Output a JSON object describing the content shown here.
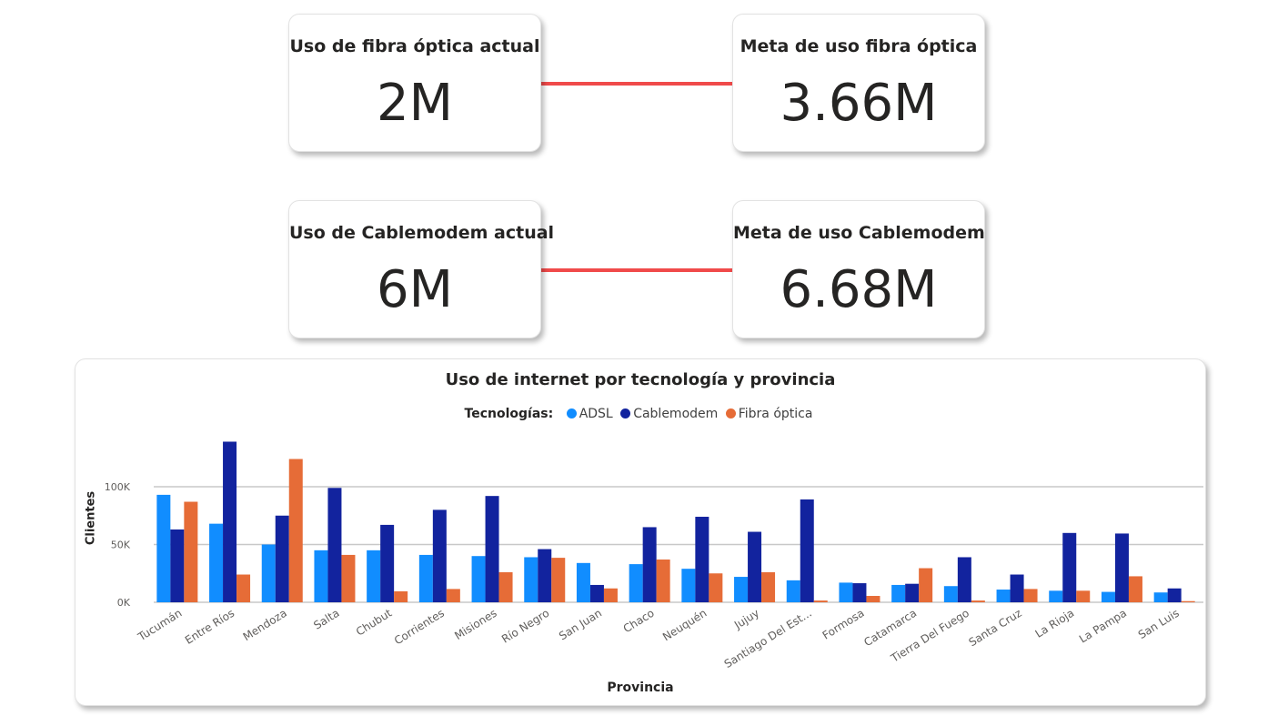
{
  "kpis": {
    "fibra_actual": {
      "title": "Uso de fibra óptica actual",
      "value": "2M"
    },
    "fibra_meta": {
      "title": "Meta de uso fibra óptica",
      "value": "3.66M"
    },
    "cable_actual": {
      "title": "Uso de Cablemodem actual",
      "value": "6M"
    },
    "cable_meta": {
      "title": "Meta de uso Cablemodem",
      "value": "6.68M"
    }
  },
  "colors": {
    "connector": "#f04a4a",
    "adsl": "#118dff",
    "cablemodem": "#12239e",
    "fibra": "#e66c37",
    "grid": "#c8c8c8"
  },
  "chart_data": {
    "type": "bar",
    "title": "Uso de internet por tecnología y provincia",
    "legend_title": "Tecnologías:",
    "legend_position": "top-center",
    "xlabel": "Provincia",
    "ylabel": "Clientes",
    "ylim": [
      0,
      145000
    ],
    "yticks": [
      0,
      50000,
      100000
    ],
    "ytick_labels": [
      "0K",
      "50K",
      "100K"
    ],
    "grid": true,
    "categories": [
      "Tucumán",
      "Entre Ríos",
      "Mendoza",
      "Salta",
      "Chubut",
      "Corrientes",
      "Misiones",
      "Río Negro",
      "San Juan",
      "Chaco",
      "Neuquén",
      "Jujuy",
      "Santiago Del Est...",
      "Formosa",
      "Catamarca",
      "Tierra Del Fuego",
      "Santa Cruz",
      "La Rioja",
      "La Pampa",
      "San Luis"
    ],
    "series": [
      {
        "name": "ADSL",
        "values": [
          93000,
          68000,
          50000,
          45000,
          45000,
          41000,
          40000,
          39000,
          34000,
          33000,
          29000,
          22000,
          19000,
          17000,
          15000,
          14000,
          11000,
          10000,
          9000,
          8500
        ]
      },
      {
        "name": "Cablemodem",
        "values": [
          63000,
          139000,
          75000,
          99000,
          67000,
          80000,
          92000,
          46000,
          15000,
          65000,
          74000,
          61000,
          89000,
          16500,
          16000,
          39000,
          24000,
          60000,
          59500,
          12000
        ]
      },
      {
        "name": "Fibra óptica",
        "values": [
          87000,
          24000,
          124000,
          41000,
          9500,
          11500,
          26000,
          38500,
          12000,
          37000,
          25000,
          26000,
          1500,
          5500,
          29500,
          1500,
          11500,
          10000,
          22500,
          1000
        ]
      }
    ]
  }
}
